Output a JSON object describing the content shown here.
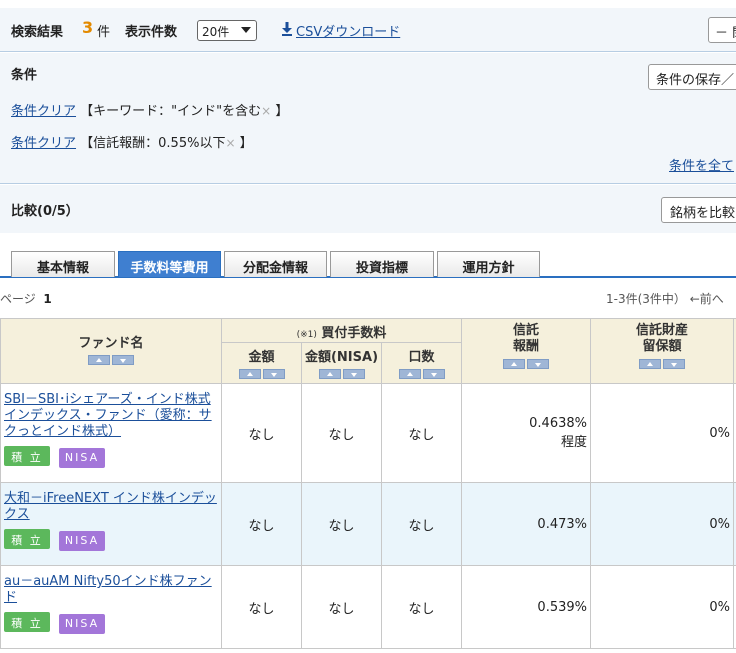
{
  "topbar": {
    "result_label": "検索結果",
    "result_count": "3",
    "result_unit": "件",
    "display_label": "表示件数",
    "display_value": "20件",
    "csv_label": "CSVダウンロード",
    "close_label": "－ 閉"
  },
  "conditions": {
    "title": "条件",
    "save_label": "条件の保存／",
    "clear_label": "条件クリア",
    "items": [
      {
        "text": "【キーワード：\"インド\"を含む",
        "end": " 】"
      },
      {
        "text": "【信託報酬：0.55%以下",
        "end": " 】"
      }
    ],
    "remove_mark": "×",
    "all_label": "条件を全て"
  },
  "compare": {
    "title": "比較(0/5）",
    "button_label": "銘柄を比較"
  },
  "tabs": [
    "基本情報",
    "手数料等費用",
    "分配金情報",
    "投資指標",
    "運用方針"
  ],
  "active_tab": 1,
  "pager": {
    "left_label": "ページ",
    "page": "1",
    "summary": "1-3件(3件中） ←前へ"
  },
  "table": {
    "headers": {
      "fund_name": "ファンド名",
      "buy_fee_note": "(※1)",
      "buy_fee": "買付手数料",
      "amount": "金額",
      "amount_nisa": "金額(NISA)",
      "units": "口数",
      "trust_fee": "信託\n報酬",
      "reserve": "信託財産\n留保額"
    },
    "rows": [
      {
        "name": "SBI－SBI･iシェアーズ・インド株式インデックス・ファンド（愛称：サクっとインド株式）",
        "badge1": "積 立",
        "badge2": "NISA",
        "amount": "なし",
        "amount_nisa": "なし",
        "units": "なし",
        "trust_fee": "0.4638%",
        "trust_fee_sub": "程度",
        "reserve": "0%"
      },
      {
        "name": "大和－iFreeNEXT インド株インデックス",
        "badge1": "積 立",
        "badge2": "NISA",
        "amount": "なし",
        "amount_nisa": "なし",
        "units": "なし",
        "trust_fee": "0.473%",
        "trust_fee_sub": "",
        "reserve": "0%"
      },
      {
        "name": "au－auAM Nifty50インド株ファンド",
        "badge1": "積 立",
        "badge2": "NISA",
        "amount": "なし",
        "amount_nisa": "なし",
        "units": "なし",
        "trust_fee": "0.539%",
        "trust_fee_sub": "",
        "reserve": "0%"
      }
    ]
  },
  "colors": {
    "accent": "#2a6fc0",
    "count": "#e38a00",
    "link": "#1b4f9a",
    "badge_tsumitate": "#5cb85c",
    "badge_nisa": "#a376d9",
    "header_bg": "#f5f0dc"
  }
}
